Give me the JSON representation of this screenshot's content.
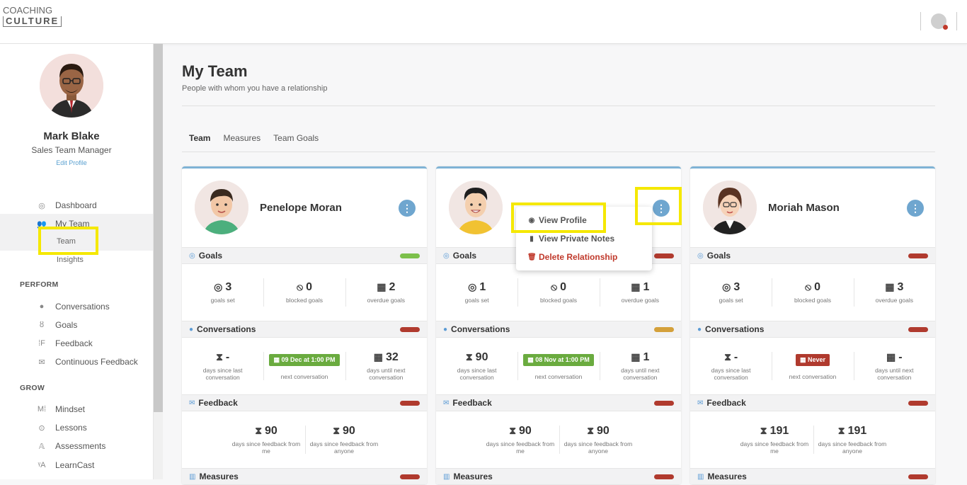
{
  "app": {
    "logo_line1": "COACHING",
    "logo_line2": "CULTURE"
  },
  "user": {
    "name": "Mark Blake",
    "role": "Sales Team Manager",
    "edit": "Edit Profile"
  },
  "nav": {
    "dashboard": "Dashboard",
    "my_team": "My Team",
    "team": "Team",
    "insights": "Insights",
    "perform": "PERFORM",
    "conversations": "Conversations",
    "goals": "Goals",
    "feedback": "Feedback",
    "continuous_feedback": "Continuous Feedback",
    "grow": "GROW",
    "mindset": "Mindset",
    "lessons": "Lessons",
    "assessments": "Assessments",
    "learncast": "LearnCast"
  },
  "page": {
    "title": "My Team",
    "subtitle": "People with whom you have a relationship"
  },
  "tabs": [
    "Team",
    "Measures",
    "Team Goals"
  ],
  "labels": {
    "goals": "Goals",
    "conversations": "Conversations",
    "feedback": "Feedback",
    "measures": "Measures",
    "goals_set": "goals set",
    "blocked_goals": "blocked goals",
    "overdue_goals": "overdue goals",
    "days_since_last": "days since last conversation",
    "next_conversation": "next conversation",
    "days_until_next": "days until next conversation",
    "fb_from_me": "days since feedback from me",
    "fb_from_anyone": "days since feedback from anyone"
  },
  "cards": [
    {
      "name": "Penelope Moran",
      "goals_set": "3",
      "blocked": "0",
      "overdue": "2",
      "goals_status": "#7cc04b",
      "conv_status": "#b03a2e",
      "fb_status": "#b03a2e",
      "meas_status": "#b03a2e",
      "days_since": "-",
      "next": "09 Dec at 1:00 PM",
      "next_color": "#6aab3f",
      "days_until": "32",
      "fb_me": "90",
      "fb_any": "90"
    },
    {
      "name": "",
      "goals_set": "1",
      "blocked": "0",
      "overdue": "1",
      "goals_status": "#b03a2e",
      "conv_status": "#d4a03a",
      "fb_status": "#b03a2e",
      "meas_status": "#b03a2e",
      "days_since": "90",
      "next": "08 Nov at 1:00 PM",
      "next_color": "#6aab3f",
      "days_until": "1",
      "fb_me": "90",
      "fb_any": "90"
    },
    {
      "name": "Moriah Mason",
      "goals_set": "3",
      "blocked": "0",
      "overdue": "3",
      "goals_status": "#b03a2e",
      "conv_status": "#b03a2e",
      "fb_status": "#b03a2e",
      "meas_status": "#b03a2e",
      "days_since": "-",
      "next": "Never",
      "next_color": "#b03a2e",
      "days_until": "-",
      "fb_me": "191",
      "fb_any": "191"
    }
  ],
  "menu": {
    "view_profile": "View Profile",
    "view_notes": "View Private Notes",
    "delete": "Delete Relationship"
  },
  "highlight_color": "#f5e800"
}
